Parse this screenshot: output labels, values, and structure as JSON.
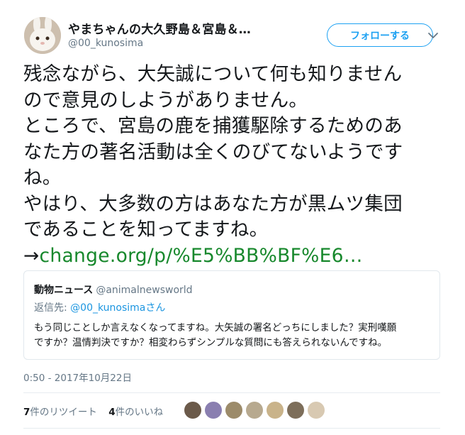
{
  "author": {
    "display_name": "やまちゃんの大久野島＆宮島＆…",
    "handle": "@00_kunosima",
    "avatar_icon": "rabbit-avatar"
  },
  "follow_button": {
    "label": "フォローする"
  },
  "tweet": {
    "lines": [
      "残念ながら、大矢誠について何も知りません",
      "ので意見のしようがありません。",
      "ところで、宮島の鹿を捕獲駆除するためのあ",
      "なた方の著名活動は全くのびてないようです",
      "ね。",
      "やはり、大多数の方はあなた方が黒ムツ集団",
      "であることを知ってますね。"
    ],
    "arrow": "→",
    "link_text": "change.org/p/%E5%BB%BF%E6…"
  },
  "quoted": {
    "name": "動物ニュース",
    "handle": "@animalnewsworld",
    "reply_prefix": "返信先: ",
    "reply_user": "@00_kunosimaさん",
    "lines": [
      "もう同じことしか言えなくなってますね。大矢誠の署名どっちにしました？実刑嘆願",
      "ですか？温情判決ですか？相変わらずシンプルな質問にも答えられないんですね。"
    ]
  },
  "timestamp": "0:50 - 2017年10月22日",
  "stats": {
    "retweets_count": "7",
    "retweets_label": "件のリツイート",
    "likes_count": "4",
    "likes_label": "件のいいね"
  },
  "likers": [
    {
      "color": "#6b5a4a"
    },
    {
      "color": "#8a7fb0"
    },
    {
      "color": "#9c8b6a"
    },
    {
      "color": "#b7a98f"
    },
    {
      "color": "#c9b38a"
    },
    {
      "color": "#7d6e5a"
    },
    {
      "color": "#d8c9b2"
    }
  ],
  "colors": {
    "accent": "#1da1f2",
    "link": "#17882c"
  }
}
